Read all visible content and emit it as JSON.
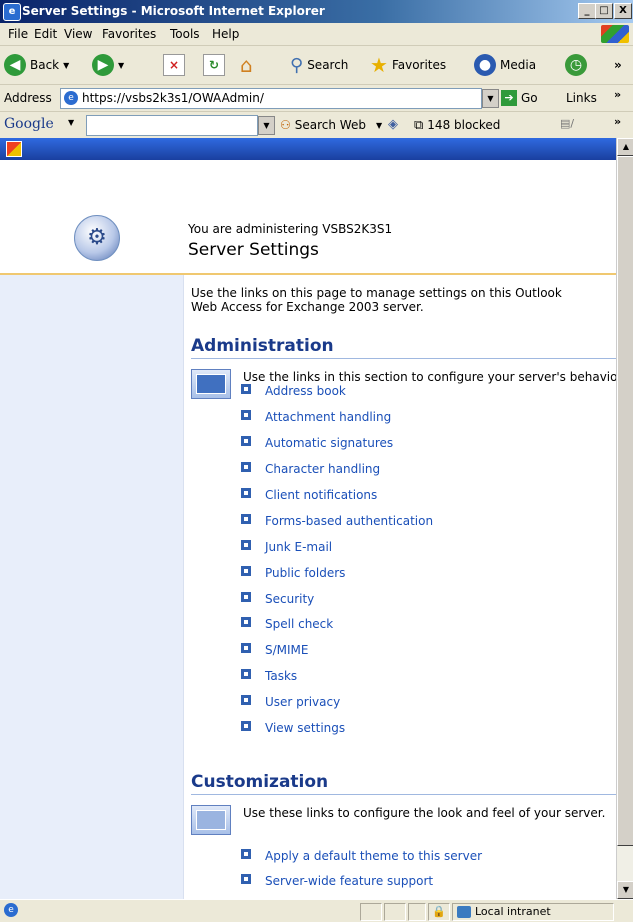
{
  "window": {
    "title": "Server Settings - Microsoft Internet Explorer",
    "min": "_",
    "max": "□",
    "close": "X"
  },
  "menu": [
    "File",
    "Edit",
    "View",
    "Favorites",
    "Tools",
    "Help"
  ],
  "toolbar": {
    "back": "Back",
    "search": "Search",
    "favorites": "Favorites",
    "media": "Media"
  },
  "address": {
    "label": "Address",
    "url": "https://vsbs2k3s1/OWAAdmin/",
    "go": "Go",
    "links": "Links"
  },
  "google": {
    "brand": "Google",
    "search_web": "Search Web",
    "blocked": "148 blocked"
  },
  "header": {
    "subtitle": "You are administering VSBS2K3S1",
    "title": "Server Settings"
  },
  "intro": "Use the links on this page to manage settings on this Outlook Web Access for Exchange 2003 server.",
  "administration": {
    "heading": "Administration",
    "description": "Use the links in this section to configure your server's behavior.",
    "links": [
      "Address book",
      "Attachment handling",
      "Automatic signatures",
      "Character handling",
      "Client notifications",
      "Forms-based authentication",
      "Junk E-mail",
      "Public folders",
      "Security",
      "Spell check",
      "S/MIME",
      "Tasks",
      "User privacy",
      "View settings"
    ]
  },
  "customization": {
    "heading": "Customization",
    "description": "Use these links to configure the look and feel of your server.",
    "links": [
      "Apply a default theme to this server",
      "Server-wide feature support"
    ]
  },
  "status": {
    "zone": "Local intranet"
  },
  "icons": [
    "ie-icon",
    "windows-flag-icon",
    "back-icon",
    "forward-icon",
    "stop-icon",
    "refresh-icon",
    "home-icon",
    "search-icon",
    "favorites-star-icon",
    "media-icon",
    "history-icon",
    "go-arrow-icon",
    "popup-blocker-icon",
    "gear-icon",
    "lock-icon"
  ]
}
